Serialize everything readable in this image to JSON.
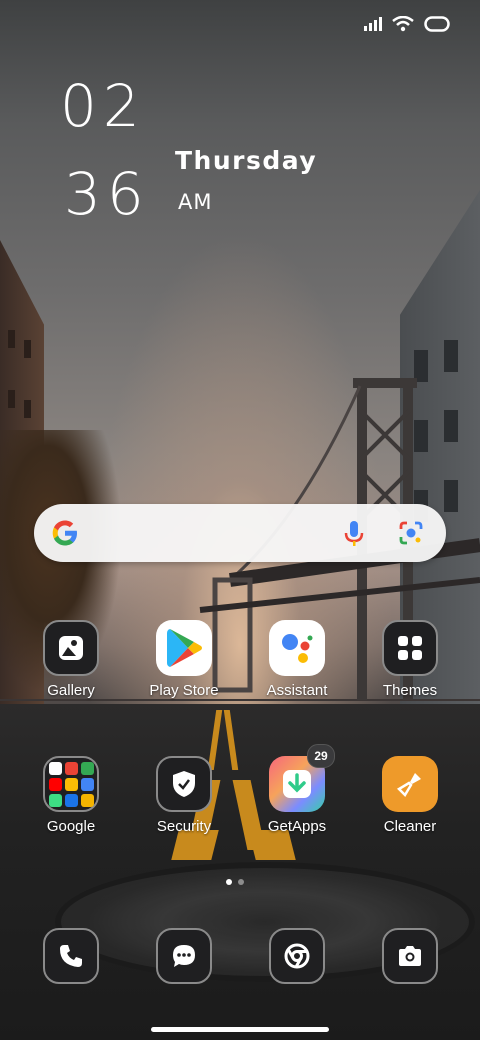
{
  "clock": {
    "hour": "02",
    "minute": "36",
    "day": "Thursday",
    "ampm": "AM"
  },
  "status_bar": {
    "icons": [
      "signal-icon",
      "wifi-icon",
      "battery-icon"
    ]
  },
  "search": {
    "icons": [
      "google-logo-icon",
      "microphone-icon",
      "lens-icon"
    ]
  },
  "apps_row1": [
    {
      "label": "Gallery",
      "icon": "gallery-icon"
    },
    {
      "label": "Play Store",
      "icon": "play-store-icon"
    },
    {
      "label": "Assistant",
      "icon": "assistant-icon"
    },
    {
      "label": "Themes",
      "icon": "themes-icon"
    }
  ],
  "apps_row2": [
    {
      "label": "Google",
      "icon": "google-folder-icon"
    },
    {
      "label": "Security",
      "icon": "security-shield-icon"
    },
    {
      "label": "GetApps",
      "icon": "getapps-icon",
      "badge": "29"
    },
    {
      "label": "Cleaner",
      "icon": "cleaner-brush-icon"
    }
  ],
  "page_indicator": {
    "count": 2,
    "active": 1
  },
  "dock": [
    {
      "icon": "phone-icon"
    },
    {
      "icon": "messages-icon"
    },
    {
      "icon": "chrome-icon"
    },
    {
      "icon": "camera-icon"
    }
  ],
  "colors": {
    "cleaner": "#EE9A2A",
    "getapps_green": "#2FCB8A",
    "google_blue": "#4285F4",
    "google_red": "#EA4335",
    "google_yellow": "#FBBC05",
    "google_green": "#34A853"
  }
}
